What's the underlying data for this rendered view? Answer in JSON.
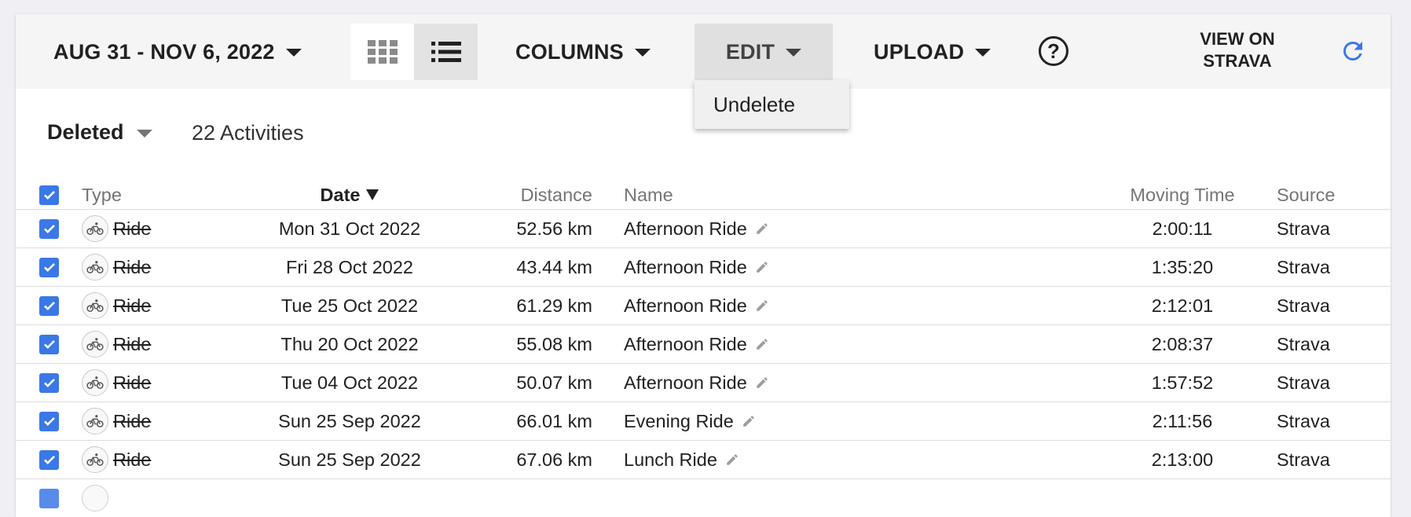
{
  "toolbar": {
    "date_range": "AUG 31 - NOV 6, 2022",
    "columns_label": "COLUMNS",
    "edit_label": "EDIT",
    "upload_label": "UPLOAD",
    "help_glyph": "?",
    "view_on_line1": "VIEW ON",
    "view_on_line2": "STRAVA",
    "active_view": "list"
  },
  "edit_menu": {
    "items": [
      "Undelete"
    ]
  },
  "filter": {
    "selected": "Deleted",
    "count_text": "22 Activities"
  },
  "table": {
    "headers": {
      "type": "Type",
      "date": "Date",
      "distance": "Distance",
      "name": "Name",
      "moving_time": "Moving Time",
      "source": "Source"
    },
    "sort": {
      "column": "Date",
      "direction": "descending"
    },
    "rows": [
      {
        "checked": true,
        "type": "Ride",
        "date": "Mon 31 Oct 2022",
        "distance": "52.56 km",
        "name": "Afternoon Ride",
        "moving_time": "2:00:11",
        "source": "Strava"
      },
      {
        "checked": true,
        "type": "Ride",
        "date": "Fri 28 Oct 2022",
        "distance": "43.44 km",
        "name": "Afternoon Ride",
        "moving_time": "1:35:20",
        "source": "Strava"
      },
      {
        "checked": true,
        "type": "Ride",
        "date": "Tue 25 Oct 2022",
        "distance": "61.29 km",
        "name": "Afternoon Ride",
        "moving_time": "2:12:01",
        "source": "Strava"
      },
      {
        "checked": true,
        "type": "Ride",
        "date": "Thu 20 Oct 2022",
        "distance": "55.08 km",
        "name": "Afternoon Ride",
        "moving_time": "2:08:37",
        "source": "Strava"
      },
      {
        "checked": true,
        "type": "Ride",
        "date": "Tue 04 Oct 2022",
        "distance": "50.07 km",
        "name": "Afternoon Ride",
        "moving_time": "1:57:52",
        "source": "Strava"
      },
      {
        "checked": true,
        "type": "Ride",
        "date": "Sun 25 Sep 2022",
        "distance": "66.01 km",
        "name": "Evening Ride",
        "moving_time": "2:11:56",
        "source": "Strava"
      },
      {
        "checked": true,
        "type": "Ride",
        "date": "Sun 25 Sep 2022",
        "distance": "67.06 km",
        "name": "Lunch Ride",
        "moving_time": "2:13:00",
        "source": "Strava"
      }
    ]
  },
  "colors": {
    "accent": "#3b78e7",
    "toolbar_bg": "#f5f5f5",
    "edit_active_bg": "#e0e0e0"
  },
  "icons": [
    "chevron-down-icon",
    "grid-view-icon",
    "list-view-icon",
    "help-icon",
    "refresh-icon",
    "bicycle-icon",
    "pencil-icon",
    "checkbox-checked-icon"
  ]
}
